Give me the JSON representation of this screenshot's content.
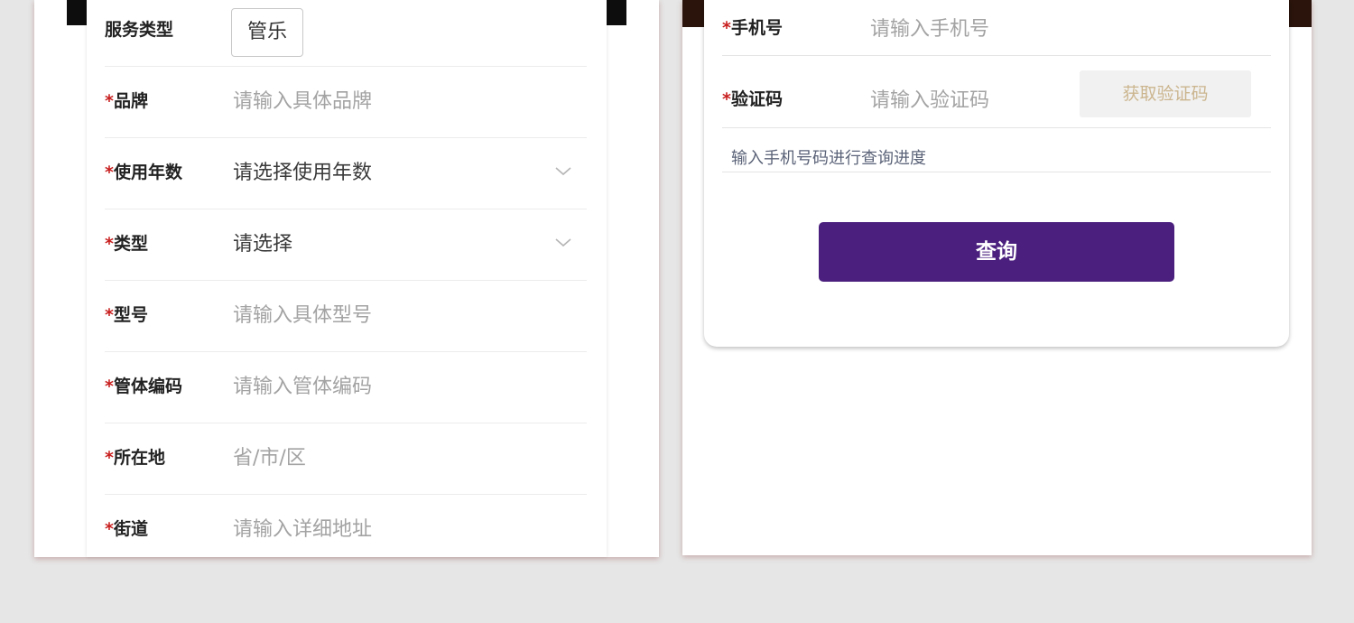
{
  "colors": {
    "background": "#e6e6e6",
    "required_star": "#c81e1e",
    "placeholder": "#a3a3a3",
    "primary_button": "#4a1f7e",
    "code_button_text": "#cbb58e"
  },
  "service_form": {
    "service_type": {
      "label": "服务类型",
      "value": "管乐"
    },
    "required_mark": "*",
    "fields": [
      {
        "label": "品牌",
        "placeholder": "请输入具体品牌",
        "type": "input"
      },
      {
        "label": "使用年数",
        "placeholder": "请选择使用年数",
        "type": "select",
        "icon": "chevron-down-icon"
      },
      {
        "label": "类型",
        "placeholder": "请选择",
        "type": "select",
        "icon": "chevron-down-icon"
      },
      {
        "label": "型号",
        "placeholder": "请输入具体型号",
        "type": "input"
      },
      {
        "label": "管体编码",
        "placeholder": "请输入管体编码",
        "type": "input"
      },
      {
        "label": "所在地",
        "placeholder": "省/市/区",
        "type": "input"
      },
      {
        "label": "街道",
        "placeholder": "请输入详细地址",
        "type": "input"
      }
    ]
  },
  "query_form": {
    "required_mark": "*",
    "phone": {
      "label": "手机号",
      "placeholder": "请输入手机号"
    },
    "code": {
      "label": "验证码",
      "placeholder": "请输入验证码",
      "button_label": "获取验证码"
    },
    "hint": "输入手机号码进行查询进度",
    "submit_label": "查询"
  }
}
